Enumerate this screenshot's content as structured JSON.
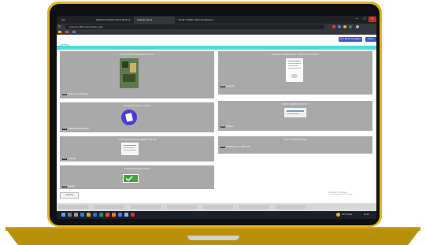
{
  "browser": {
    "tabs": [
      {
        "label": "app"
      },
      {
        "label": "Dashboard SIMA Online Berhitun..."
      },
      {
        "label": "siakad.ut.ac.id..."
      },
      {
        "label": "Jurnal | TOEFL Ujian Kompetensi..."
      }
    ],
    "url": "sinta.kemdikbud.go.id/app_ujian"
  },
  "header": {
    "button_primary": "Kirim Berkas Pengajuan",
    "button_secondary": "Keluar"
  },
  "cards": [
    {
      "title": "FOTO FORMULIR PENDAFTARAN",
      "label": "Formulir_01_1P30-9.jpg"
    },
    {
      "title": "TRANSKRIP NILAI / IJAZAH",
      "label": "Transkrip nilai_ijazah.pdf"
    },
    {
      "title": "SURAT KETERANGAN BEBAS PINJAM",
      "label": "Surat.jpg"
    },
    {
      "title": "TOEFL/ELPT/SERTIFIKAT",
      "label": "toefl.jpg"
    },
    {
      "title": "LEMBAR PENGESAHAN / SURAT PENGANTAR",
      "label": "Surat.pdf"
    },
    {
      "title": "BUKTI PEMBAYARAN UKT",
      "label": "Bukti.jpg"
    },
    {
      "title": "BUKTI PENDAFTARAN",
      "label": "Pendaftaran_01_1P30-9.pdf"
    }
  ],
  "foot": {
    "back_button": "Kembali"
  },
  "watermark": {
    "title": "Activate Windows",
    "subtitle": "Go to Settings to activate Windows."
  },
  "taskbar": {
    "weather": "29°C Kabut",
    "time": "10:45"
  }
}
